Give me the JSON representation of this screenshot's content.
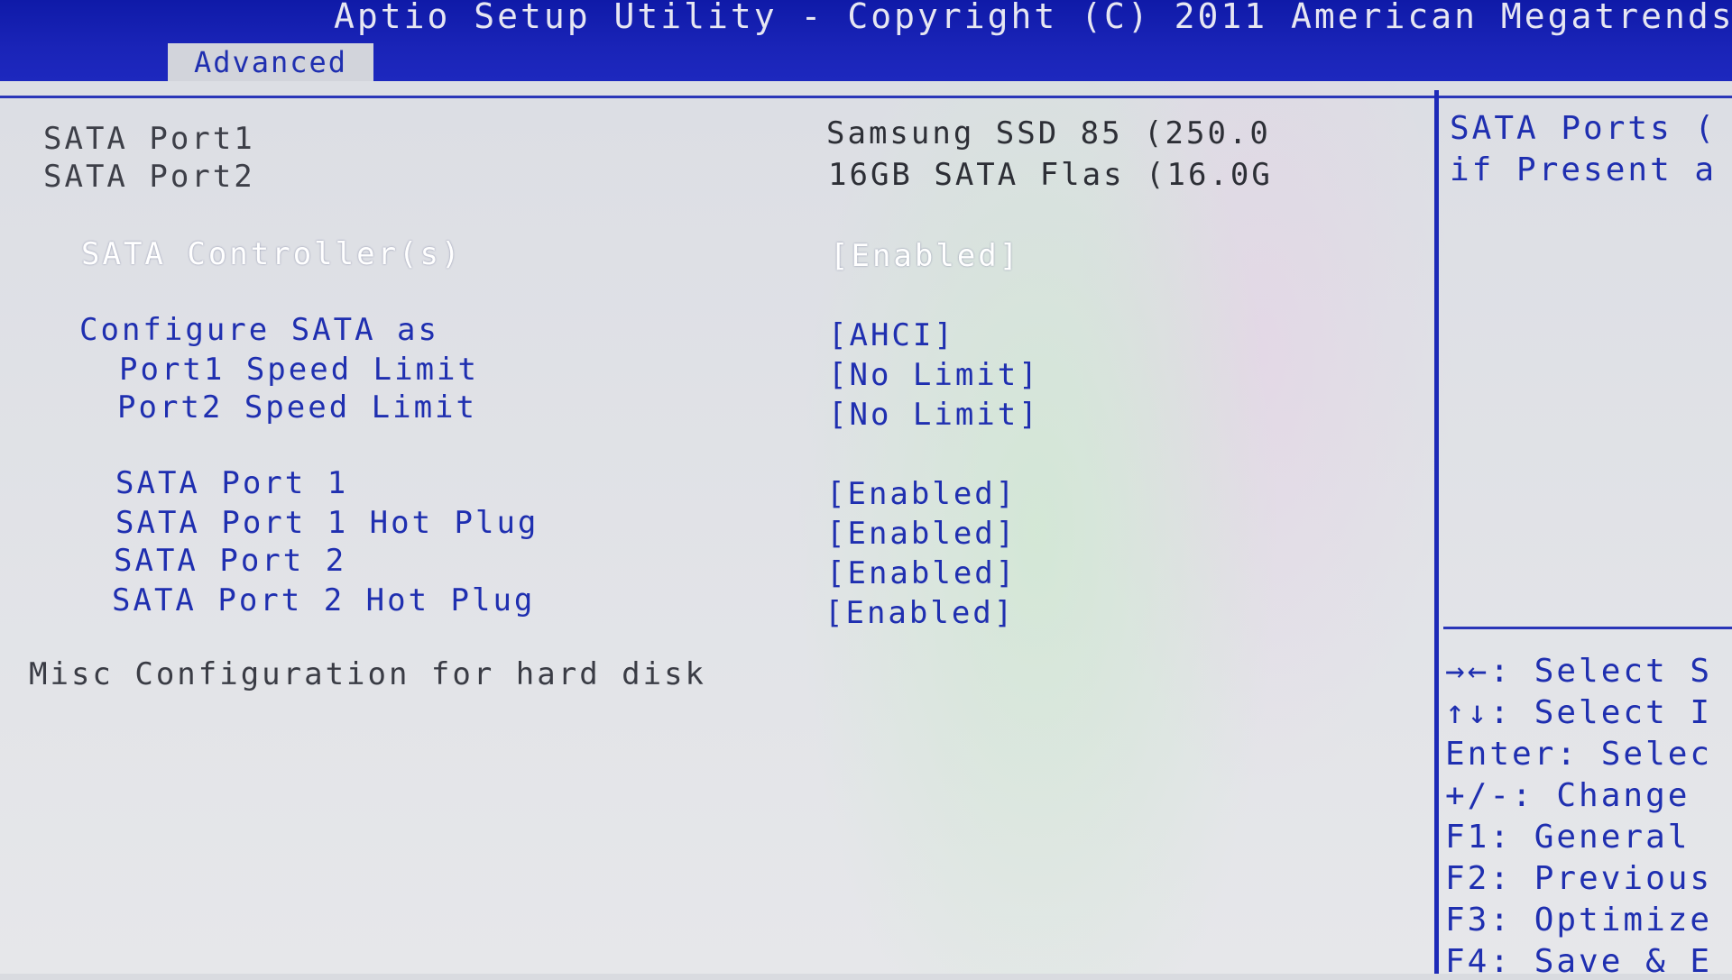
{
  "header": {
    "title": "Aptio Setup Utility - Copyright (C) 2011 American Megatrends,",
    "active_tab": "Advanced"
  },
  "info_rows": [
    {
      "label": "SATA Port1",
      "value": "Samsung SSD 85 (250.0"
    },
    {
      "label": "SATA Port2",
      "value": "16GB SATA Flas (16.0G"
    }
  ],
  "settings": [
    {
      "label": "SATA Controller(s)",
      "value": "[Enabled]",
      "selected": true
    },
    {
      "label": "Configure SATA as",
      "value": "[AHCI]"
    },
    {
      "label": "Port1 Speed Limit",
      "value": "[No Limit]"
    },
    {
      "label": "Port2 Speed Limit",
      "value": "[No Limit]"
    },
    {
      "label": "SATA Port 1",
      "value": "[Enabled]"
    },
    {
      "label": "SATA Port 1 Hot Plug",
      "value": "[Enabled]"
    },
    {
      "label": "SATA Port 2",
      "value": "[Enabled]"
    },
    {
      "label": "SATA Port 2 Hot Plug",
      "value": "[Enabled]"
    }
  ],
  "misc_text": "Misc Configuration for hard disk",
  "help": {
    "lines": [
      "SATA Ports (",
      "if Present a"
    ]
  },
  "keys": [
    "→←: Select S",
    "↑↓: Select I",
    "Enter: Selec",
    "+/-: Change",
    "F1: General",
    "F2: Previous",
    "F3: Optimize",
    "F4: Save & E"
  ],
  "colors": {
    "header_bg": "#1a24b8",
    "accent_blue": "#1f2fb0",
    "panel_bg": "#dcdee4"
  }
}
